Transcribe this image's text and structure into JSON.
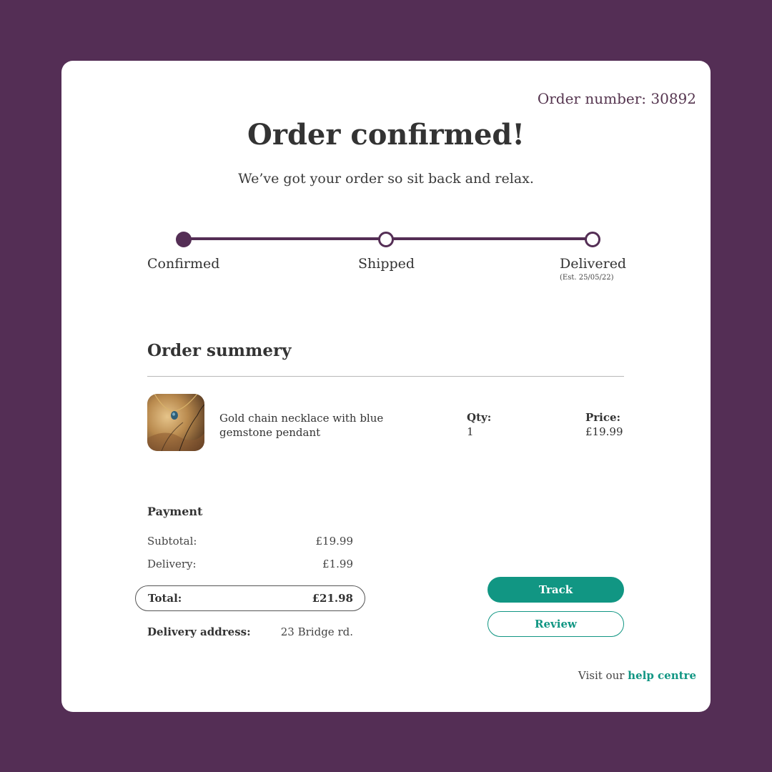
{
  "colors": {
    "background": "#542e55",
    "accent": "#542e55",
    "primary_button": "#119683",
    "link": "#119683"
  },
  "order": {
    "number_label": "Order number: 30892"
  },
  "header": {
    "title": "Order confirmed!",
    "subtitle": "We’ve got your order so sit back and relax."
  },
  "progress": {
    "steps": [
      {
        "label": "Confirmed",
        "state": "complete"
      },
      {
        "label": "Shipped",
        "state": "pending"
      },
      {
        "label": "Delivered",
        "state": "pending",
        "note": "(Est. 25/05/22)"
      }
    ]
  },
  "summary": {
    "heading": "Order summery",
    "item": {
      "image_icon": "necklace-photo",
      "name": "Gold chain necklace with blue gemstone pendant",
      "qty_label": "Qty:",
      "qty": "1",
      "price_label": "Price:",
      "price": "£19.99"
    }
  },
  "payment": {
    "heading": "Payment",
    "subtotal_label": "Subtotal:",
    "subtotal": "£19.99",
    "delivery_label": "Delivery:",
    "delivery": "£1.99",
    "total_label": "Total:",
    "total": "£21.98",
    "address_label": "Delivery address:",
    "address": "23 Bridge rd."
  },
  "actions": {
    "track_label": "Track",
    "review_label": "Review"
  },
  "help": {
    "prefix": "Visit our ",
    "link_label": "help centre"
  }
}
